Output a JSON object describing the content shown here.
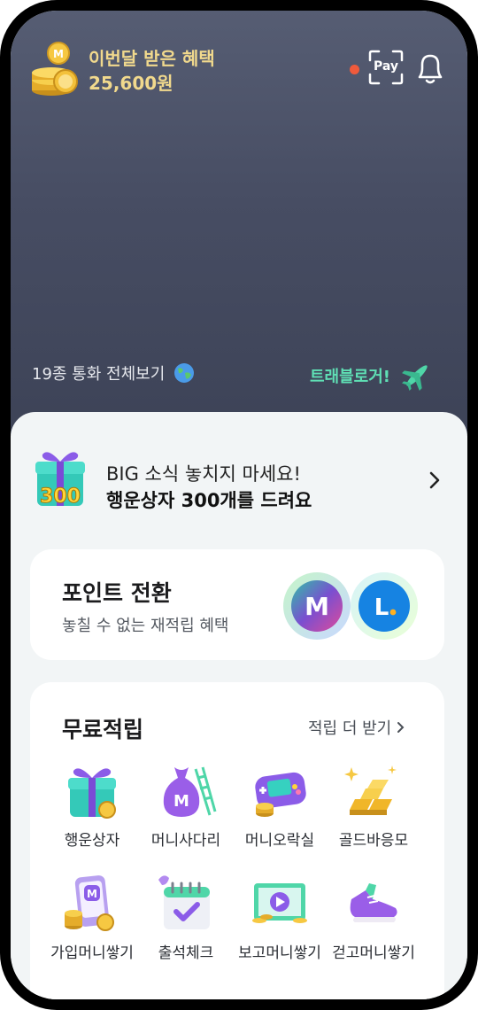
{
  "header": {
    "benefit_title": "이번달 받은 혜택",
    "benefit_amount": "25,600원",
    "pay_label": "Pay",
    "icons": [
      "coin-stack-icon",
      "notification-dot-icon",
      "pay-scan-icon",
      "bell-icon"
    ]
  },
  "hero": {
    "currency_link": "19종 통화 전체보기",
    "travel_link": "트래블로거!",
    "icons": [
      "globe-icon",
      "airplane-icon"
    ]
  },
  "notice": {
    "line1": "BIG 소식 놓치지 마세요!",
    "line2": "행운상자 300개를 드려요",
    "badge_number": "300",
    "icons": [
      "gift-box-icon",
      "chevron-right-icon"
    ]
  },
  "points": {
    "title": "포인트 전환",
    "subtitle": "놓칠 수 없는 재적립 혜택",
    "logo_m": "M",
    "logo_l": "L"
  },
  "free_earn": {
    "title": "무료적립",
    "more_label": "적립 더 받기",
    "items": [
      {
        "label": "행운상자",
        "icon": "gift-box-icon"
      },
      {
        "label": "머니사다리",
        "icon": "money-bag-ladder-icon"
      },
      {
        "label": "머니오락실",
        "icon": "game-console-icon"
      },
      {
        "label": "골드바응모",
        "icon": "gold-bar-icon"
      },
      {
        "label": "가입머니쌓기",
        "icon": "phone-coins-icon"
      },
      {
        "label": "출석체크",
        "icon": "calendar-check-icon"
      },
      {
        "label": "보고머니쌓기",
        "icon": "video-play-icon"
      },
      {
        "label": "걷고머니쌓기",
        "icon": "sneaker-icon"
      }
    ]
  },
  "colors": {
    "hero_top": "#565d73",
    "hero_bottom": "#3d4357",
    "benefit_text": "#f1d98d",
    "travel_accent": "#5fe0b5",
    "notification_dot": "#ef5a3c",
    "sheet_bg": "#f2f5f6"
  }
}
